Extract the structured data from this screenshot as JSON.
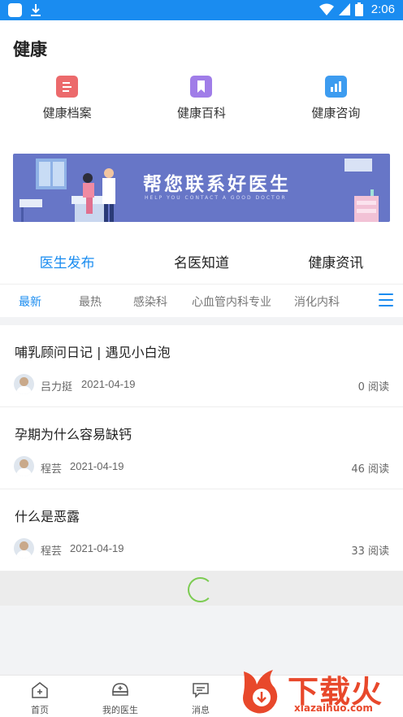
{
  "status_bar": {
    "time": "2:06"
  },
  "page": {
    "title": "健康"
  },
  "shortcuts": [
    {
      "label": "健康档案",
      "icon": "health-record-icon",
      "color": "#ec6a6c"
    },
    {
      "label": "健康百科",
      "icon": "encyclopedia-bookmark-icon",
      "color": "#a07de8"
    },
    {
      "label": "健康咨询",
      "icon": "consultation-chart-icon",
      "color": "#3d9cf0"
    }
  ],
  "banner": {
    "text": "帮您联系好医生",
    "subtext": "HELP YOU CONTACT A GOOD DOCTOR",
    "background": "#6776c7"
  },
  "tabs": [
    {
      "label": "医生发布",
      "active": true
    },
    {
      "label": "名医知道",
      "active": false
    },
    {
      "label": "健康资讯",
      "active": false
    }
  ],
  "subtabs": [
    {
      "label": "最新",
      "active": true
    },
    {
      "label": "最热",
      "active": false
    },
    {
      "label": "感染科",
      "active": false
    },
    {
      "label": "心血管内科专业",
      "active": false
    },
    {
      "label": "消化内科",
      "active": false
    }
  ],
  "articles": [
    {
      "title": "哺乳顾问日记 | 遇见小白泡",
      "author": "吕力挺",
      "date": "2021-04-19",
      "reads": "0 阅读"
    },
    {
      "title": "孕期为什么容易缺钙",
      "author": "程芸",
      "date": "2021-04-19",
      "reads": "46 阅读"
    },
    {
      "title": "什么是恶露",
      "author": "程芸",
      "date": "2021-04-19",
      "reads": "33 阅读"
    }
  ],
  "bottom_nav": [
    {
      "label": "首页",
      "icon": "home-plus-icon"
    },
    {
      "label": "我的医生",
      "icon": "doctor-cap-icon"
    },
    {
      "label": "消息",
      "icon": "message-icon"
    }
  ],
  "watermark": {
    "text": "下载火",
    "url": "xiazaihuo.com"
  },
  "colors": {
    "primary": "#1a8cf0",
    "spinner": "#7ccc52",
    "watermark": "#e8482b"
  }
}
